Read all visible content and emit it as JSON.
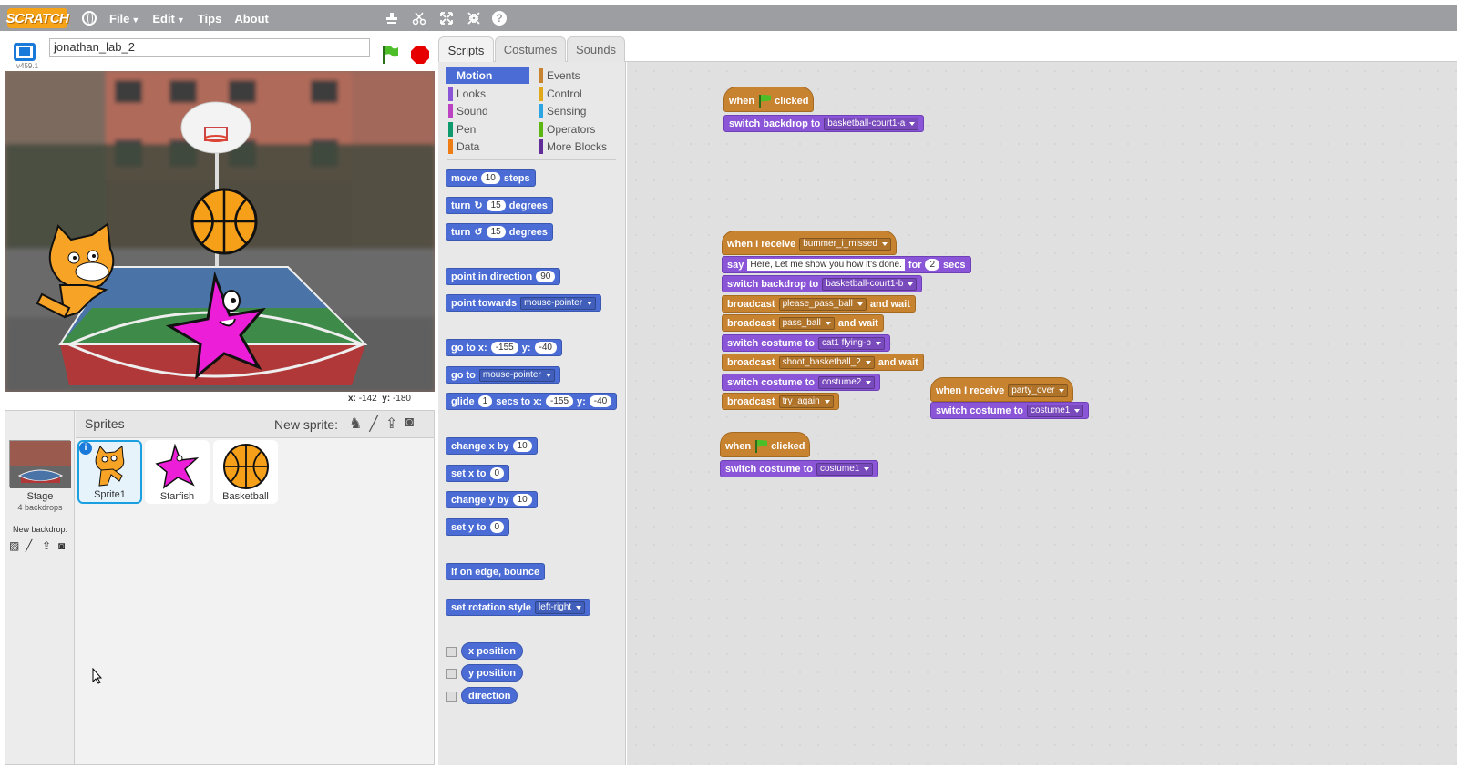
{
  "menubar": {
    "logo": "SCRATCH",
    "file": "File",
    "edit": "Edit",
    "tips": "Tips",
    "about": "About",
    "help": "?"
  },
  "stage": {
    "version": "v459.1",
    "project_name": "jonathan_lab_2",
    "x_label": "x:",
    "x_value": "-142",
    "y_label": "y:",
    "y_value": "-180"
  },
  "tabs": [
    "Scripts",
    "Costumes",
    "Sounds"
  ],
  "categories": [
    {
      "label": "Motion",
      "color": "#4a6cd4"
    },
    {
      "label": "Looks",
      "color": "#8a55d7"
    },
    {
      "label": "Sound",
      "color": "#bb42c3"
    },
    {
      "label": "Pen",
      "color": "#0e9a6c"
    },
    {
      "label": "Data",
      "color": "#ee7d16"
    },
    {
      "label": "Events",
      "color": "#c88330"
    },
    {
      "label": "Control",
      "color": "#e1a91a"
    },
    {
      "label": "Sensing",
      "color": "#2ca5e2"
    },
    {
      "label": "Operators",
      "color": "#5cb712"
    },
    {
      "label": "More Blocks",
      "color": "#632d99"
    }
  ],
  "palette": {
    "move": "move",
    "move_n": "10",
    "steps": "steps",
    "turn": "turn",
    "turn_n": "15",
    "degrees": "degrees",
    "point_dir": "point in direction",
    "point_dir_v": "90",
    "point_towards": "point towards",
    "point_towards_v": "mouse-pointer",
    "goto": "go to x:",
    "goto_x": "-155",
    "y": "y:",
    "goto_y": "-40",
    "goto2": "go to",
    "goto2_v": "mouse-pointer",
    "glide": "glide",
    "glide_n": "1",
    "secs_to_x": "secs to x:",
    "glide_x": "-155",
    "glide_y": "-40",
    "change_x": "change x by",
    "change_x_v": "10",
    "set_x": "set x to",
    "set_x_v": "0",
    "change_y": "change y by",
    "change_y_v": "10",
    "set_y": "set y to",
    "set_y_v": "0",
    "bounce": "if on edge, bounce",
    "rot_style": "set rotation style",
    "rot_style_v": "left-right",
    "xpos": "x position",
    "ypos": "y position",
    "direction": "direction"
  },
  "scripts": {
    "when": "when",
    "clicked": "clicked",
    "switch_backdrop": "switch backdrop to",
    "backdrop_a": "basketball-court1-a",
    "backdrop_b": "basketball-court1-b",
    "when_receive": "when I receive",
    "msg_missed": "bummer_i_missed",
    "say": "say",
    "say_text": "Here, Let me show you how it's done.",
    "for": "for",
    "say_secs": "2",
    "secs": "secs",
    "broadcast": "broadcast",
    "and_wait": "and wait",
    "msg_please": "please_pass_ball",
    "msg_pass": "pass_ball",
    "switch_costume": "switch costume to",
    "costume_cat": "cat1 flying-b",
    "msg_shoot": "shoot_basketball_2",
    "costume2": "costume2",
    "msg_try": "try_again",
    "msg_party": "party_over",
    "costume1": "costume1"
  },
  "sprites": {
    "title": "Sprites",
    "new_sprite": "New sprite:",
    "stage_name": "Stage",
    "stage_sub": "4 backdrops",
    "new_backdrop": "New backdrop:",
    "items": [
      {
        "name": "Sprite1",
        "info": "i"
      },
      {
        "name": "Starfish"
      },
      {
        "name": "Basketball"
      }
    ]
  }
}
